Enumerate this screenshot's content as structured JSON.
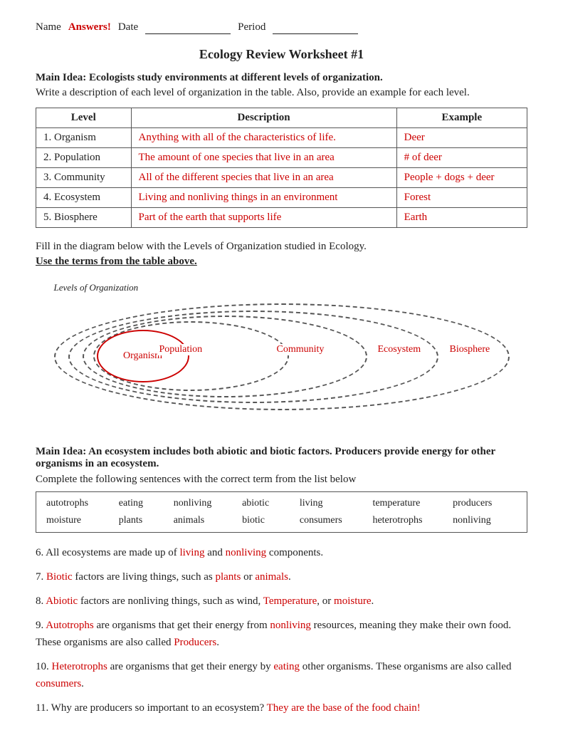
{
  "header": {
    "name_label": "Name",
    "answers_label": "Answers!",
    "date_label": "Date",
    "period_label": "Period"
  },
  "title": "Ecology Review Worksheet #1",
  "section1": {
    "main_idea": "Main Idea:  Ecologists study environments at different levels of organization.",
    "instruction": "Write a description of each level of organization in the table.  Also, provide an example for each level.",
    "table": {
      "headers": [
        "Level",
        "Description",
        "Example"
      ],
      "rows": [
        {
          "level": "1. Organism",
          "description": "Anything with all of the characteristics of life.",
          "example": "Deer"
        },
        {
          "level": "2. Population",
          "description": "The amount of one species that live in an area",
          "example": "# of deer"
        },
        {
          "level": "3. Community",
          "description": "All of the different species that live in an area",
          "example": "People + dogs  + deer"
        },
        {
          "level": "4. Ecosystem",
          "description": "Living and nonliving things in an environment",
          "example": "Forest"
        },
        {
          "level": "5. Biosphere",
          "description": "Part of the earth that supports life",
          "example": "Earth"
        }
      ]
    }
  },
  "diagram": {
    "fill_instruction": "Fill in the diagram below with the Levels of Organization studied in Ecology.",
    "use_terms": "Use the terms from the table above.",
    "diagram_label": "Levels of Organization",
    "labels": {
      "organism": "Organism",
      "population": "Population",
      "community": "Community",
      "ecosystem": "Ecosystem",
      "biosphere": "Biosphere"
    }
  },
  "section2": {
    "main_idea": "Main Idea:  An ecosystem includes both abiotic and biotic factors.  Producers provide energy for other organisms in an ecosystem.",
    "complete_instruction": "Complete the following sentences with the correct term from the list below",
    "word_bank": [
      "autotrophs",
      "eating",
      "nonliving",
      "abiotic",
      "living",
      "temperature",
      "producers",
      "moisture",
      "plants",
      "animals",
      "biotic",
      "consumers",
      "heterotrophs",
      "nonliving"
    ],
    "sentences": [
      {
        "id": "6",
        "parts": [
          {
            "text": "6. All ecosystems are made up of ",
            "color": "normal"
          },
          {
            "text": "living",
            "color": "red"
          },
          {
            "text": " and ",
            "color": "normal"
          },
          {
            "text": "nonliving",
            "color": "red"
          },
          {
            "text": " components.",
            "color": "normal"
          }
        ]
      },
      {
        "id": "7",
        "parts": [
          {
            "text": "7. ",
            "color": "normal"
          },
          {
            "text": "Biotic",
            "color": "red"
          },
          {
            "text": " factors are living things, such as ",
            "color": "normal"
          },
          {
            "text": "plants",
            "color": "red"
          },
          {
            "text": " or ",
            "color": "normal"
          },
          {
            "text": "animals",
            "color": "red"
          },
          {
            "text": ".",
            "color": "normal"
          }
        ]
      },
      {
        "id": "8",
        "parts": [
          {
            "text": "8. ",
            "color": "normal"
          },
          {
            "text": "Abiotic",
            "color": "red"
          },
          {
            "text": " factors are nonliving things, such as wind, ",
            "color": "normal"
          },
          {
            "text": "Temperature",
            "color": "red"
          },
          {
            "text": ", or ",
            "color": "normal"
          },
          {
            "text": "moisture",
            "color": "red"
          },
          {
            "text": ".",
            "color": "normal"
          }
        ]
      },
      {
        "id": "9",
        "parts": [
          {
            "text": "9. ",
            "color": "normal"
          },
          {
            "text": "Autotrophs",
            "color": "red"
          },
          {
            "text": " are organisms that get their energy from ",
            "color": "normal"
          },
          {
            "text": "nonliving",
            "color": "red"
          },
          {
            "text": " resources, meaning they make their own food.  These organisms are also called ",
            "color": "normal"
          },
          {
            "text": "Producers",
            "color": "red"
          },
          {
            "text": ".",
            "color": "normal"
          }
        ]
      },
      {
        "id": "10",
        "parts": [
          {
            "text": "10. ",
            "color": "normal"
          },
          {
            "text": "Heterotrophs",
            "color": "red"
          },
          {
            "text": " are organisms that get their energy by ",
            "color": "normal"
          },
          {
            "text": "eating",
            "color": "red"
          },
          {
            "text": " other organisms.  These organisms are also called ",
            "color": "normal"
          },
          {
            "text": "consumers",
            "color": "red"
          },
          {
            "text": ".",
            "color": "normal"
          }
        ]
      },
      {
        "id": "11",
        "parts": [
          {
            "text": "11. Why are producers so important to an ecosystem? ",
            "color": "normal"
          },
          {
            "text": "They are the base of the food chain!",
            "color": "red"
          }
        ]
      }
    ]
  }
}
